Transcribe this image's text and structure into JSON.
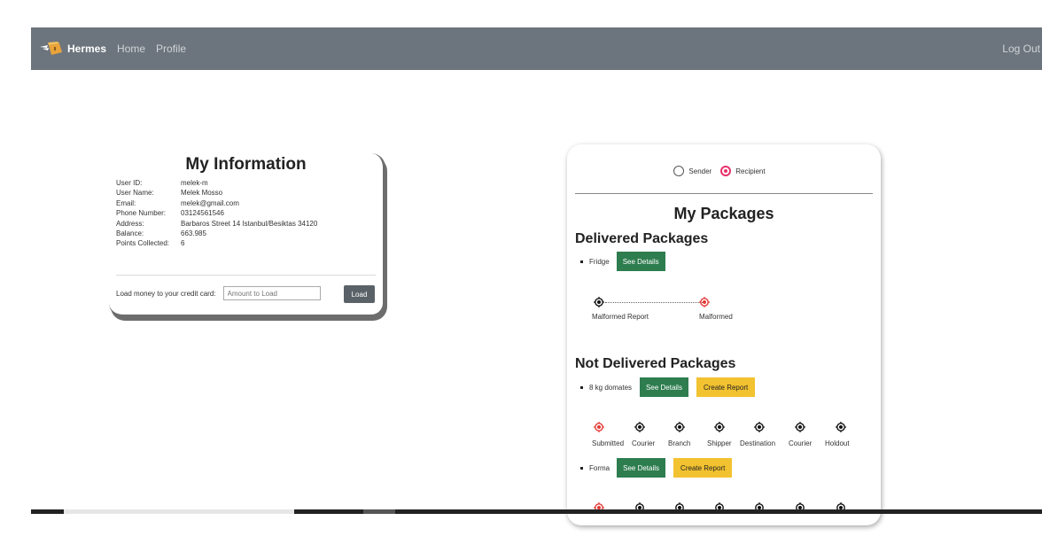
{
  "navbar": {
    "brand": "Hermes",
    "links": [
      "Home",
      "Profile"
    ],
    "logout": "Log Out"
  },
  "info": {
    "title": "My Information",
    "rows": [
      {
        "k": "User ID:",
        "v": "melek-m"
      },
      {
        "k": "User Name:",
        "v": "Melek Mosso"
      },
      {
        "k": "Email:",
        "v": "melek@gmail.com"
      },
      {
        "k": "Phone Number:",
        "v": "03124561546"
      },
      {
        "k": "Address:",
        "v": "Barbaros Street 14 Istanbul/Besiktas 34120"
      },
      {
        "k": "Balance:",
        "v": "663.985"
      },
      {
        "k": "Points Collected:",
        "v": "6"
      }
    ],
    "load_label": "Load money to your credit card:",
    "load_placeholder": "Amount to Load",
    "load_button": "Load"
  },
  "packages": {
    "radio_sender": "Sender",
    "radio_recipient": "Recipient",
    "selected": "Recipient",
    "title": "My Packages",
    "delivered_title": "Delivered Packages",
    "not_delivered_title": "Not Delivered Packages",
    "see_details": "See Details",
    "create_report": "Create Report",
    "delivered": [
      {
        "name": "Fridge",
        "steps": [
          "Malformed Report",
          "Malformed"
        ]
      }
    ],
    "not_delivered": [
      {
        "name": "8 kg domates",
        "steps": [
          "Submitted",
          "Courier",
          "Branch",
          "Shipper",
          "Destination",
          "Courier",
          "Holdout"
        ]
      },
      {
        "name": "Forma"
      }
    ]
  },
  "colors": {
    "navbar": "#6c757d",
    "green": "#2e7d4f",
    "yellow": "#f2c230",
    "active_step": "#e53935",
    "radio_selected": "#e8306b"
  }
}
